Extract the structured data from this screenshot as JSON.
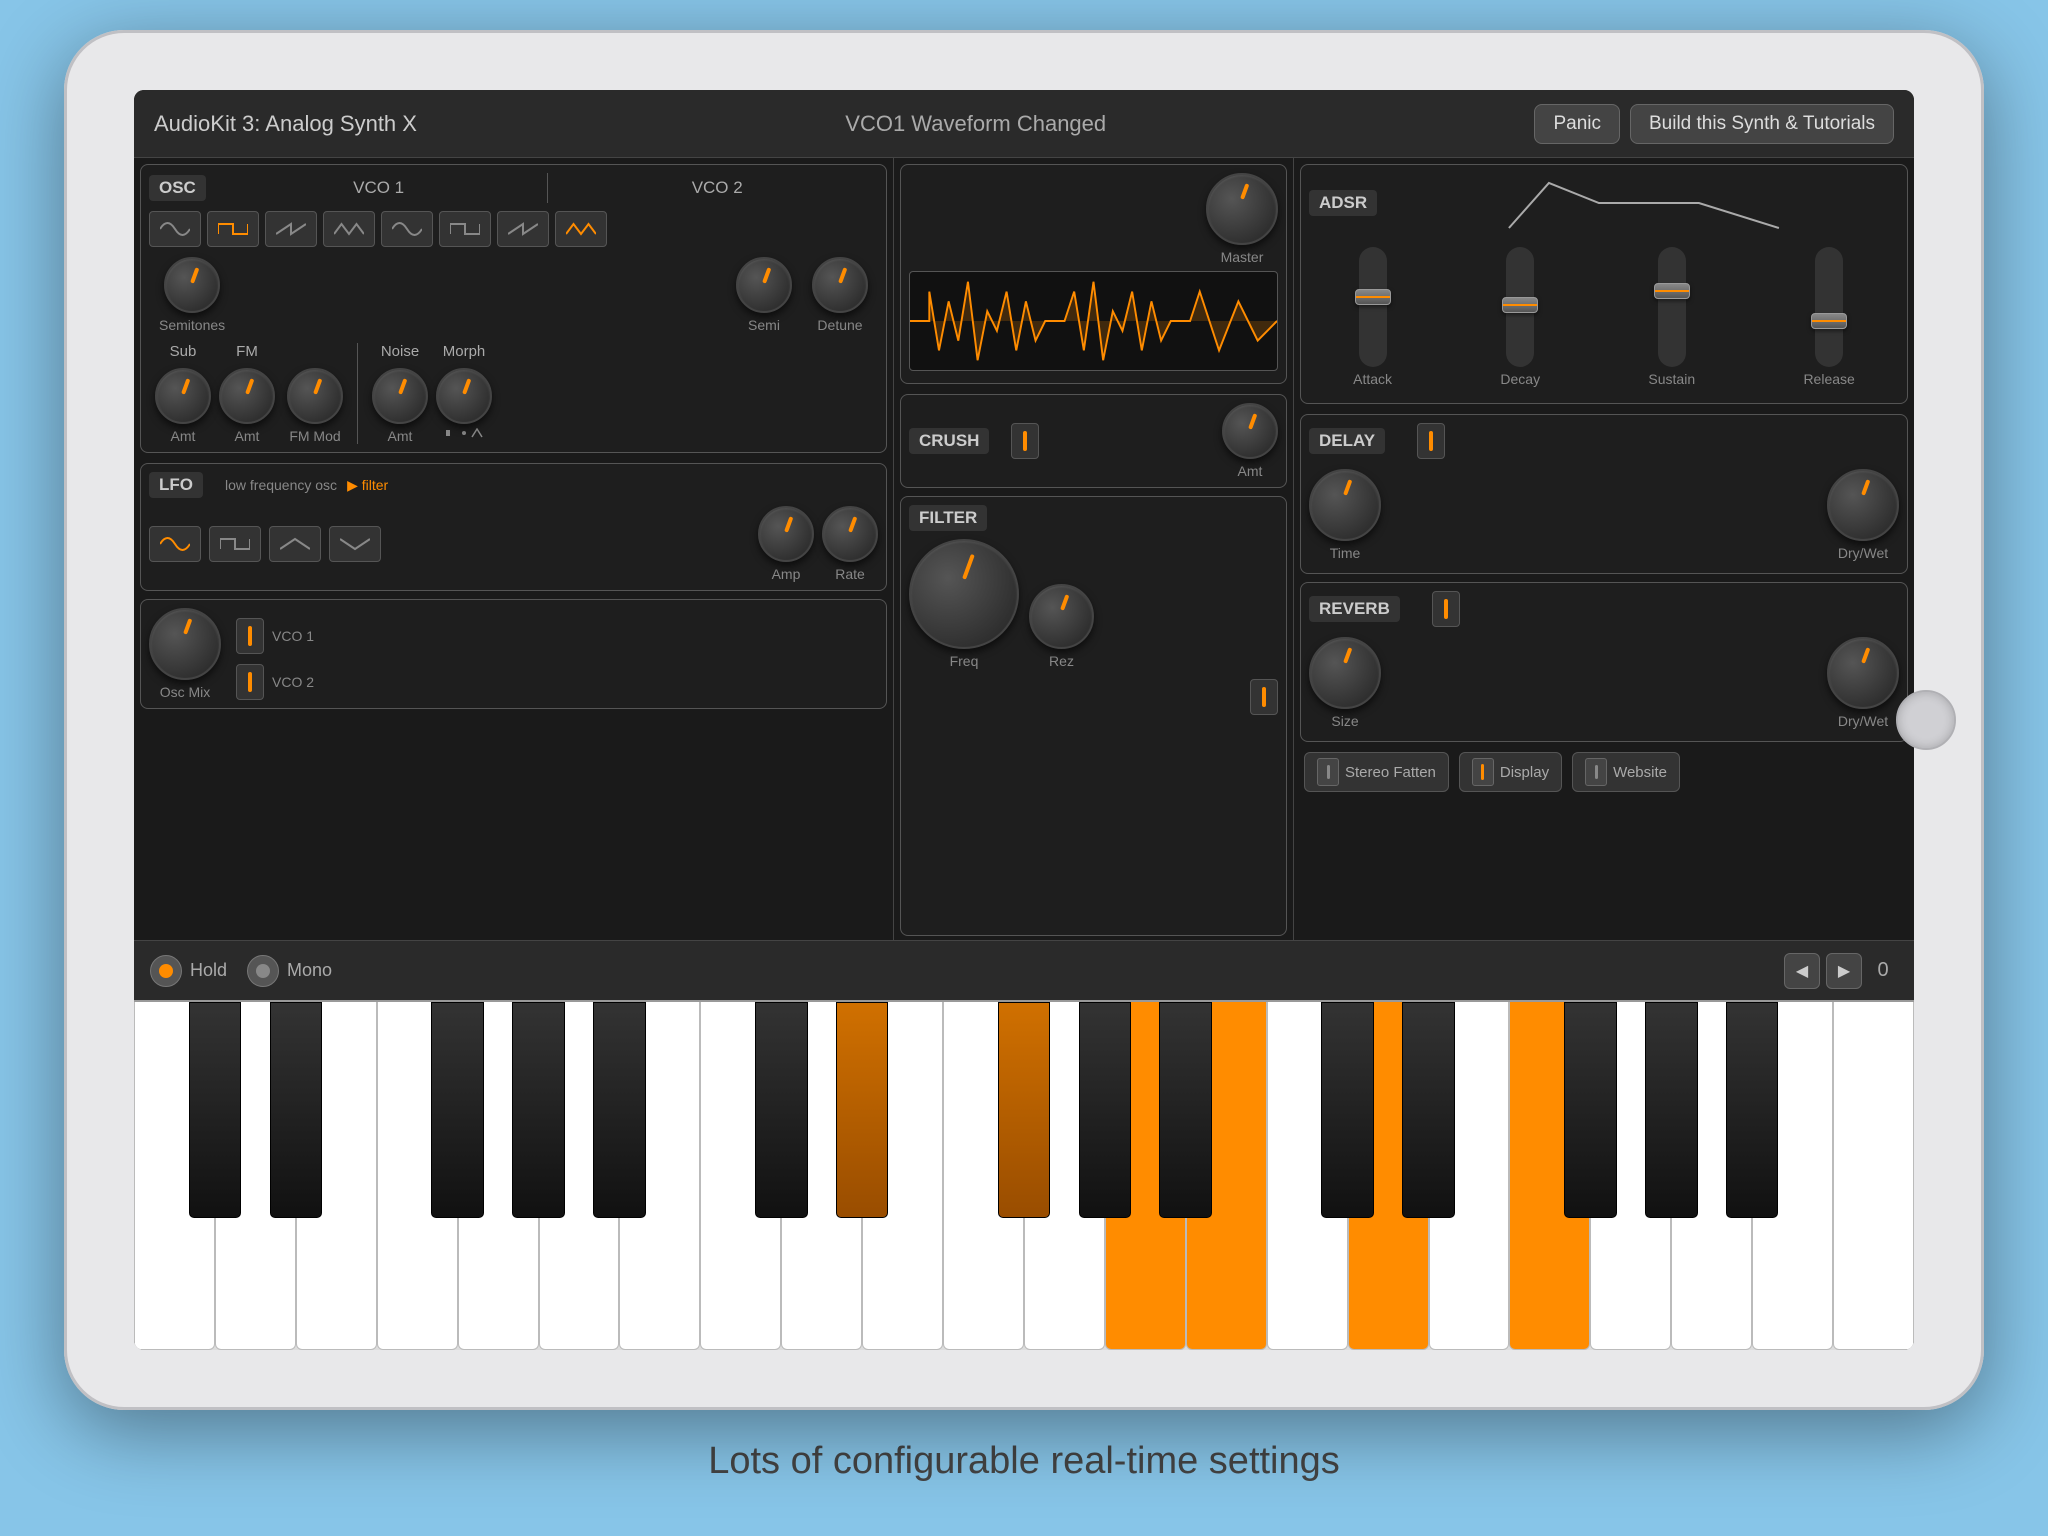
{
  "app": {
    "title": "AudioKit 3: Analog Synth X",
    "status": "VCO1 Waveform Changed",
    "panic_label": "Panic",
    "build_label": "Build this Synth & Tutorials"
  },
  "osc": {
    "label": "OSC",
    "vco1_label": "VCO 1",
    "vco2_label": "VCO 2",
    "semitones_label": "Semitones",
    "semi_detune_label": "Semi Detune",
    "sub_label": "Sub",
    "fm_label": "FM",
    "noise_label": "Noise",
    "morph_label": "Morph",
    "amt_label": "Amt",
    "fm_mod_label": "FM Mod"
  },
  "lfo": {
    "label": "LFO",
    "filter_label": "low frequency osc",
    "filter_arrow": "▶ filter",
    "amp_label": "Amp",
    "rate_label": "Rate"
  },
  "vco_mix": {
    "master_label": "Master",
    "osc_mix_label": "Osc Mix",
    "vco1_label": "VCO 1",
    "vco2_label": "VCO 2"
  },
  "crush": {
    "label": "CRUSH",
    "amt_label": "Amt"
  },
  "filter": {
    "label": "FILTER",
    "freq_label": "Freq",
    "rez_label": "Rez"
  },
  "adsr": {
    "label": "ADSR",
    "attack_label": "Attack",
    "decay_label": "Decay",
    "sustain_label": "Sustain",
    "release_label": "Release"
  },
  "delay": {
    "label": "DELAY",
    "time_label": "Time",
    "dry_wet_label": "Dry/Wet"
  },
  "reverb": {
    "label": "REVERB",
    "size_label": "Size",
    "dry_wet_label": "Dry/Wet"
  },
  "bottom_buttons": {
    "stereo_fatten_label": "Stereo Fatten",
    "display_label": "Display",
    "website_label": "Website"
  },
  "transport": {
    "hold_label": "Hold",
    "mono_label": "Mono",
    "octave": "0"
  },
  "caption": "Lots of configurable real-time settings",
  "piano": {
    "active_white_keys": [
      12,
      13,
      15,
      17
    ],
    "active_black_keys": [
      8,
      10
    ]
  }
}
